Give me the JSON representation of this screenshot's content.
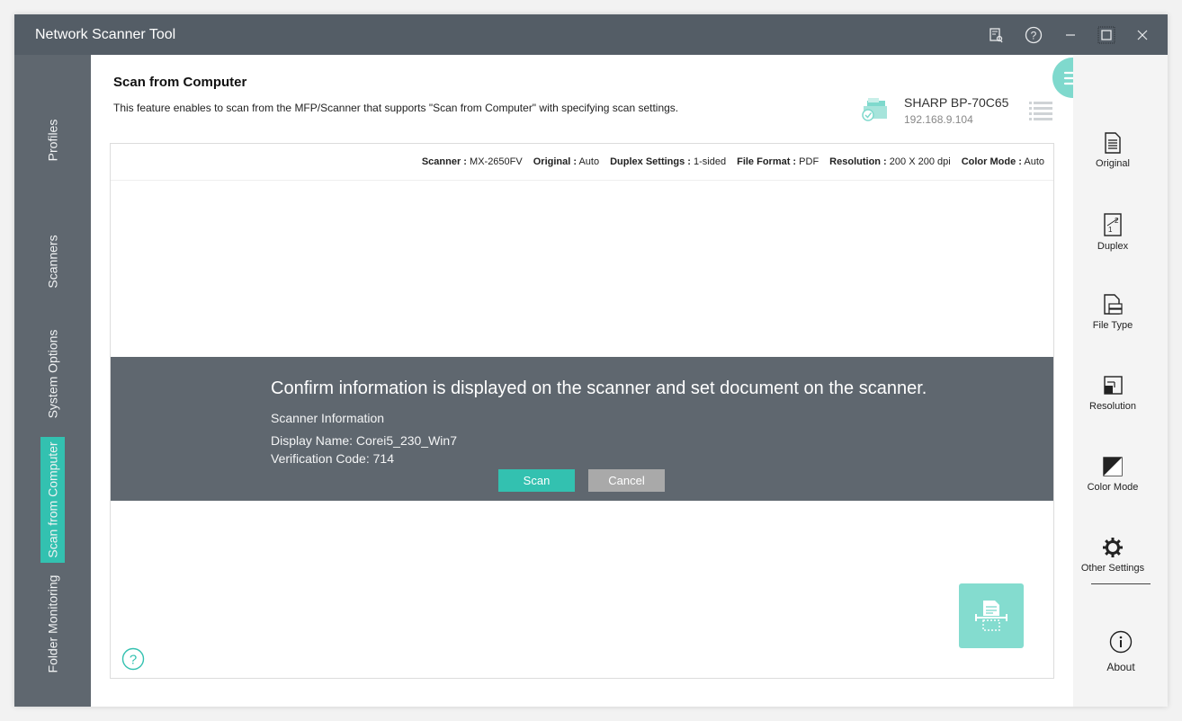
{
  "app": {
    "title": "Network Scanner Tool"
  },
  "titlebar": {
    "icons": [
      "license-icon",
      "help-icon",
      "minimize-icon",
      "maximize-icon",
      "close-icon"
    ]
  },
  "left_nav": {
    "items": [
      {
        "label": "Profiles",
        "active": false
      },
      {
        "label": "Scanners",
        "active": false
      },
      {
        "label": "System Options",
        "active": false
      },
      {
        "label": "Scan from Computer",
        "active": true
      },
      {
        "label": "Folder Monitoring",
        "active": false
      }
    ]
  },
  "page": {
    "title": "Scan from Computer",
    "description": "This feature enables to scan from the MFP/Scanner that supports \"Scan from Computer\" with specifying scan settings."
  },
  "device": {
    "name": "SHARP BP-70C65",
    "ip": "192.168.9.104"
  },
  "summary": [
    {
      "key": "Scanner :",
      "value": "MX-2650FV"
    },
    {
      "key": "Original :",
      "value": "Auto"
    },
    {
      "key": "Duplex Settings :",
      "value": "1-sided"
    },
    {
      "key": "File Format :",
      "value": "PDF"
    },
    {
      "key": "Resolution :",
      "value": "200 X 200 dpi"
    },
    {
      "key": "Color Mode :",
      "value": "Auto"
    }
  ],
  "confirm": {
    "message": "Confirm information is displayed on the scanner and set document on the scanner.",
    "info_title": "Scanner Information",
    "display_name": "Display Name: Corei5_230_Win7",
    "verification_code": "Verification Code: 714",
    "scan_label": "Scan",
    "cancel_label": "Cancel"
  },
  "right_bar": {
    "items": [
      {
        "label": "Original",
        "icon": "original-icon"
      },
      {
        "label": "Duplex",
        "icon": "duplex-icon"
      },
      {
        "label": "File Type",
        "icon": "file-type-icon"
      },
      {
        "label": "Resolution",
        "icon": "resolution-icon"
      },
      {
        "label": "Color Mode",
        "icon": "color-mode-icon"
      },
      {
        "label": "Other Settings",
        "icon": "gear-icon"
      }
    ],
    "about_label": "About"
  },
  "colors": {
    "titlebar": "#545d66",
    "nav": "#5f676f",
    "accent": "#33c1b0",
    "accent_light": "#84dccf",
    "cancel": "#a9a9a9"
  }
}
